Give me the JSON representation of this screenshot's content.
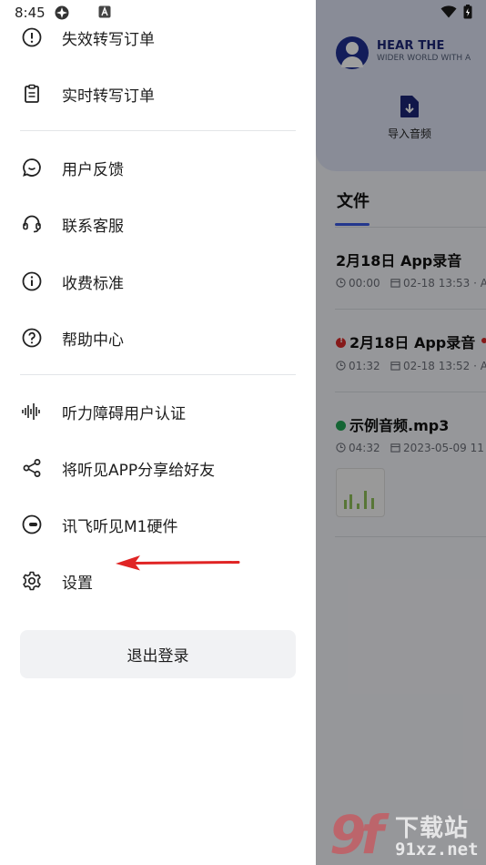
{
  "status_bar": {
    "time": "8:45"
  },
  "drawer": {
    "items": [
      {
        "label": "失效转写订单",
        "icon": "alert-circle-icon"
      },
      {
        "label": "实时转写订单",
        "icon": "clipboard-icon"
      },
      {
        "label": "用户反馈",
        "icon": "chat-bubble-icon"
      },
      {
        "label": "联系客服",
        "icon": "headset-icon"
      },
      {
        "label": "收费标准",
        "icon": "info-icon"
      },
      {
        "label": "帮助中心",
        "icon": "help-icon"
      },
      {
        "label": "听力障碍用户认证",
        "icon": "sound-wave-icon"
      },
      {
        "label": "将听见APP分享给好友",
        "icon": "share-icon"
      },
      {
        "label": "讯飞听见M1硬件",
        "icon": "device-icon"
      },
      {
        "label": "设置",
        "icon": "gear-icon"
      }
    ],
    "logout_label": "退出登录"
  },
  "background_app": {
    "brand": "HEAR THE",
    "brand_sub": "WIDER WORLD WITH A",
    "import_label": "导入音频",
    "tab_label": "文件",
    "files": [
      {
        "title": "2月18日 App录音",
        "duration": "00:00",
        "date": "02-18  13:53 · A",
        "status": "none"
      },
      {
        "title": "2月18日 App录音",
        "duration": "01:32",
        "date": "02-18  13:52 · A",
        "status": "error"
      },
      {
        "title": "示例音频.mp3",
        "duration": "04:32",
        "date": "2023-05-09  11",
        "status": "success"
      }
    ]
  },
  "watermark": {
    "text1": "下载站",
    "text2": "91xz.net",
    "logo": "9f"
  },
  "colors": {
    "accent": "#3b59e4",
    "error": "#d92a2a",
    "success": "#23a455",
    "annotation_arrow": "#e02424"
  }
}
